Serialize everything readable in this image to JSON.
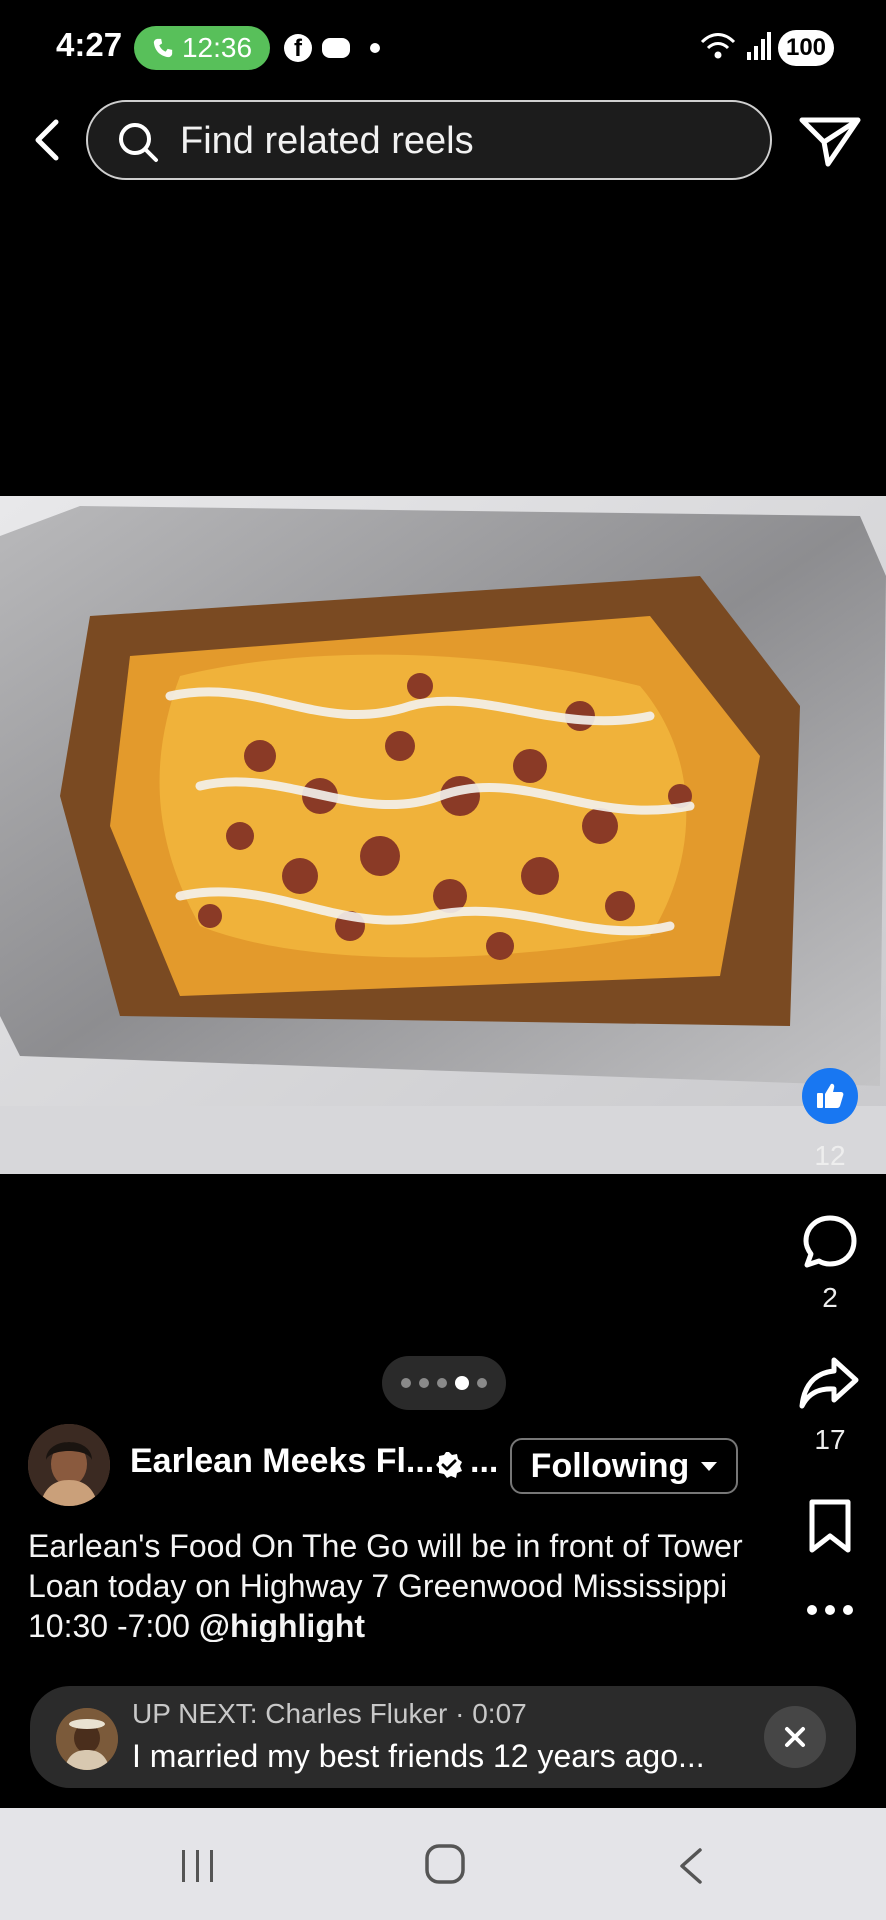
{
  "status_bar": {
    "time": "4:27",
    "call_timer": "12:36",
    "battery": "100"
  },
  "search": {
    "placeholder": "Find related reels"
  },
  "reel": {
    "like_count": "12",
    "comment_count": "2",
    "share_count": "17",
    "pager": {
      "total": 5,
      "active_index": 3
    }
  },
  "author": {
    "name": "Earlean Meeks Fl...",
    "ellipsis": "...",
    "follow_label": "Following"
  },
  "caption": {
    "text": "Earlean's Food On The Go will be in front of Tower Loan today on Highway 7 Greenwood Mississippi 10:30 -7:00 ",
    "tag": "@highlight"
  },
  "up_next": {
    "label": "UP NEXT: Charles Fluker · 0:07",
    "title": "I married my best friends 12 years ago..."
  },
  "colors": {
    "like_blue": "#1877f2",
    "call_green": "#58c05a",
    "background": "#000000"
  },
  "icons": [
    "phone-icon",
    "facebook-icon",
    "messenger-icon",
    "wifi-icon",
    "signal-icon",
    "back-arrow-icon",
    "search-icon",
    "send-icon",
    "thumbs-up-icon",
    "comment-icon",
    "share-icon",
    "bookmark-icon",
    "more-icon",
    "verified-icon",
    "chevron-down-icon",
    "close-icon",
    "recents-icon",
    "home-icon",
    "nav-back-icon"
  ]
}
